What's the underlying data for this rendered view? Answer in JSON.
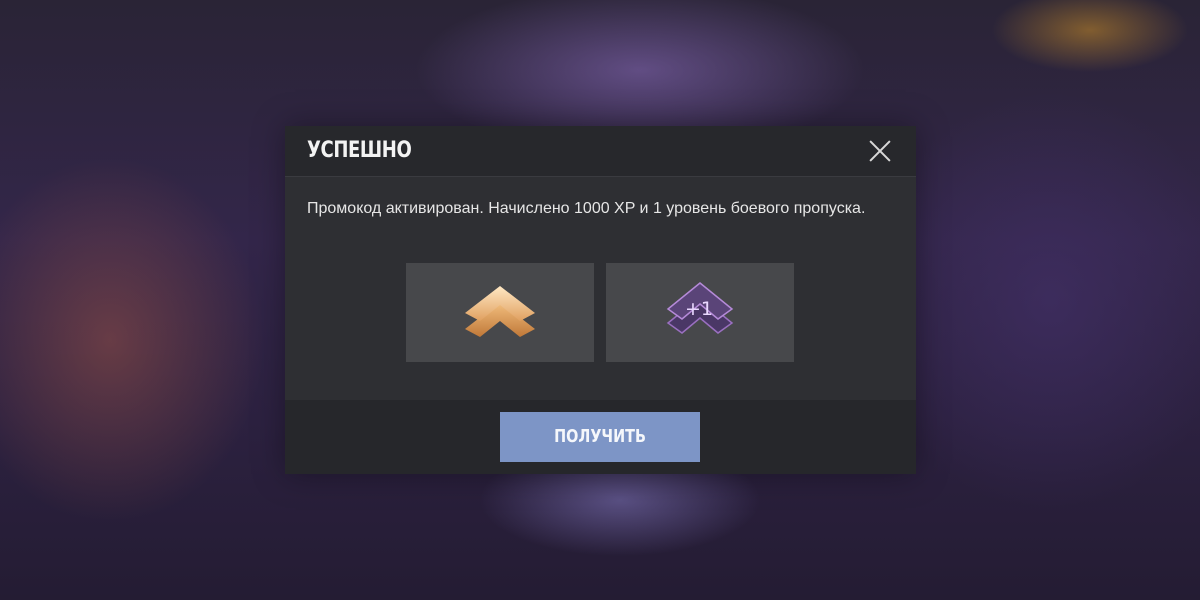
{
  "dialog": {
    "title": "УСПЕШНО",
    "message": "Промокод активирован. Начислено 1000 XP и 1 уровень боевого пропуска.",
    "rewards": [
      {
        "icon": "xp-chevron-icon",
        "label": ""
      },
      {
        "icon": "battle-pass-level-icon",
        "label": "+1"
      }
    ],
    "button_label": "ПОЛУЧИТЬ",
    "close_icon": "close-icon"
  },
  "colors": {
    "button": "#7d95c6",
    "dialog_bg": "#2e2f33",
    "header_bg": "#27282c",
    "tile_bg": "#47484b",
    "xp_icon": "#f5c98a",
    "level_icon": "#6a4a8a"
  }
}
